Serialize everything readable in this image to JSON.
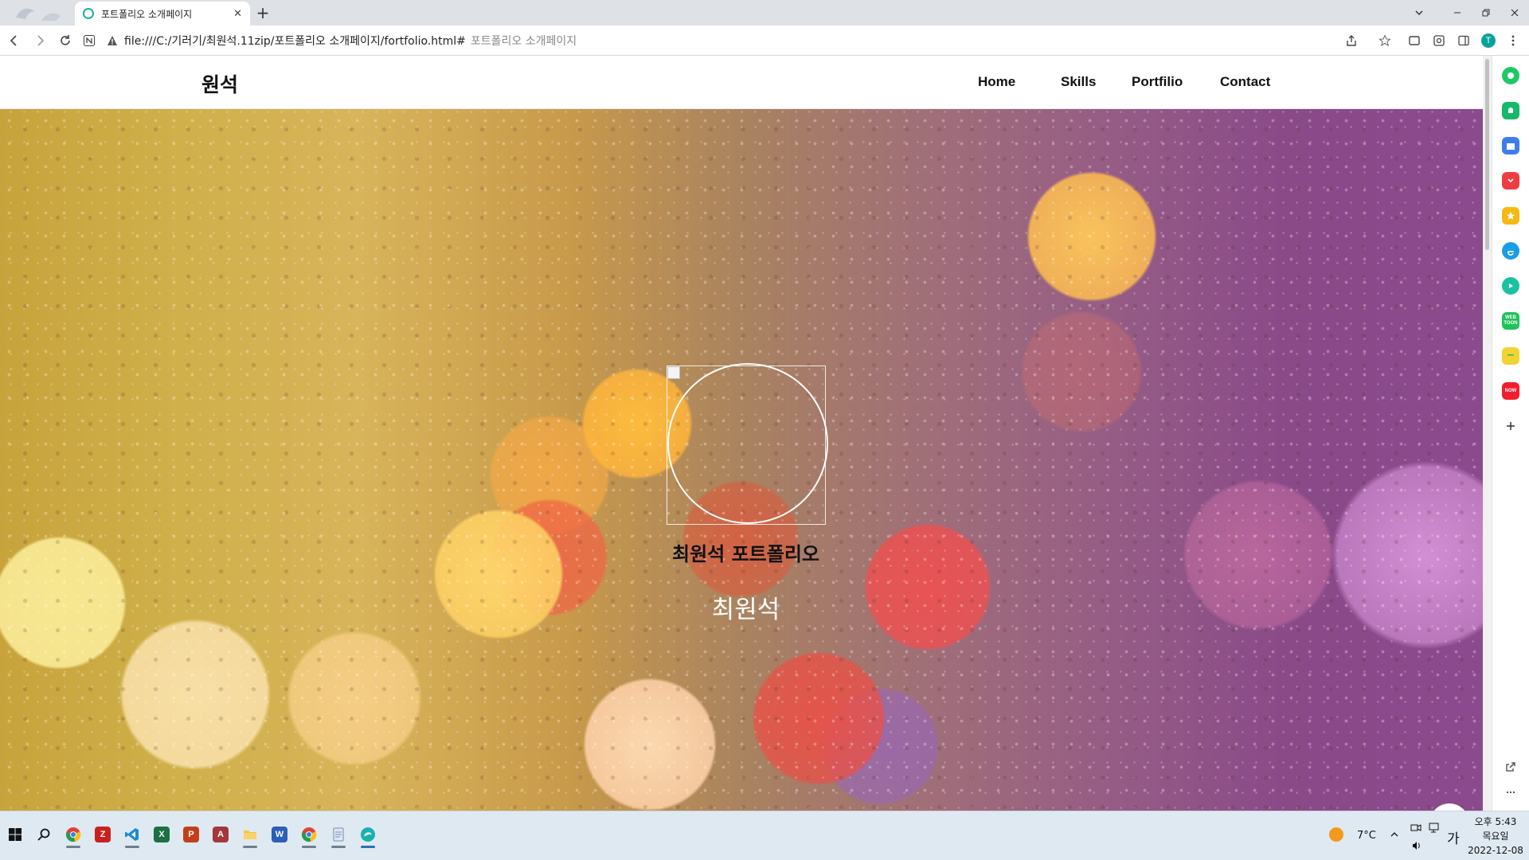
{
  "browser": {
    "tab_title": "포트폴리오 소개페이지",
    "tab_close": "✕",
    "new_tab": "+",
    "url": "file:///C:/기러기/최원석.11zip/포트폴리오 소개페이지/fortfolio.html#",
    "url_suffix": "포트폴리오 소개페이지",
    "profile_initial": "T",
    "accent": "#1bb1a0"
  },
  "site": {
    "logo": "원석",
    "nav": [
      "Home",
      "Skills",
      "Portfilio",
      "Contact"
    ]
  },
  "hero": {
    "title": "최원석 포트폴리오",
    "subtitle": "최원석"
  },
  "sidepanel": {
    "icons": [
      "chat-icon",
      "bell-icon",
      "calendar-icon",
      "pocket-icon",
      "star-icon",
      "edge-icon",
      "music-icon",
      "webtoon-icon",
      "memo-icon",
      "shopping-icon"
    ],
    "webtoon_label": "WEB TOON",
    "shopping_label": "NOW"
  },
  "taskbar": {
    "apps": [
      "chrome",
      "filezilla",
      "vscode",
      "excel",
      "powerpoint",
      "access",
      "file-explorer",
      "word",
      "chrome",
      "notepad",
      "edge"
    ],
    "weather": "7°C",
    "ime": "가",
    "time": "오후 5:43",
    "day": "목요일",
    "date": "2022-12-08"
  }
}
